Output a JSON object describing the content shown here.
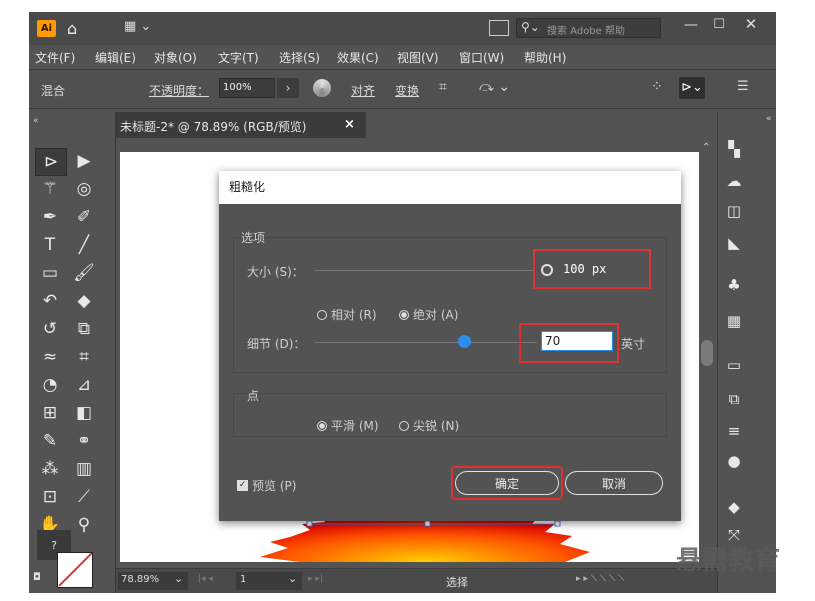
{
  "titlebar": {
    "app_logo": "Ai",
    "search_placeholder": "搜索 Adobe 帮助"
  },
  "menu": [
    "文件(F)",
    "编辑(E)",
    "对象(O)",
    "文字(T)",
    "选择(S)",
    "效果(C)",
    "视图(V)",
    "窗口(W)",
    "帮助(H)"
  ],
  "control": {
    "blend_label": "混合",
    "opacity_label": "不透明度：",
    "opacity_value": "100%",
    "align_label": "对齐",
    "transform_label": "变换"
  },
  "doc_tab": {
    "title": "未标题-2* @ 78.89% (RGB/预览)",
    "close": "×"
  },
  "dialog": {
    "title": "粗糙化",
    "options_label": "选项",
    "size_label": "大小 (S)：",
    "size_value": "100 px",
    "relative_label": "相对 (R)",
    "absolute_label": "绝对 (A)",
    "detail_label": "细节 (D)：",
    "detail_value": "70",
    "detail_unit": "英寸",
    "points_label": "点",
    "smooth_label": "平滑 (M)",
    "corner_label": "尖锐 (N)",
    "preview_label": "预览 (P)",
    "ok_label": "确定",
    "cancel_label": "取消"
  },
  "status": {
    "zoom": "78.89%",
    "page": "1",
    "tool_name": "选择"
  },
  "watermark": "悬需教育",
  "colors": {
    "accent_red": "#e03030",
    "slider_blue": "#2c8cf0"
  }
}
